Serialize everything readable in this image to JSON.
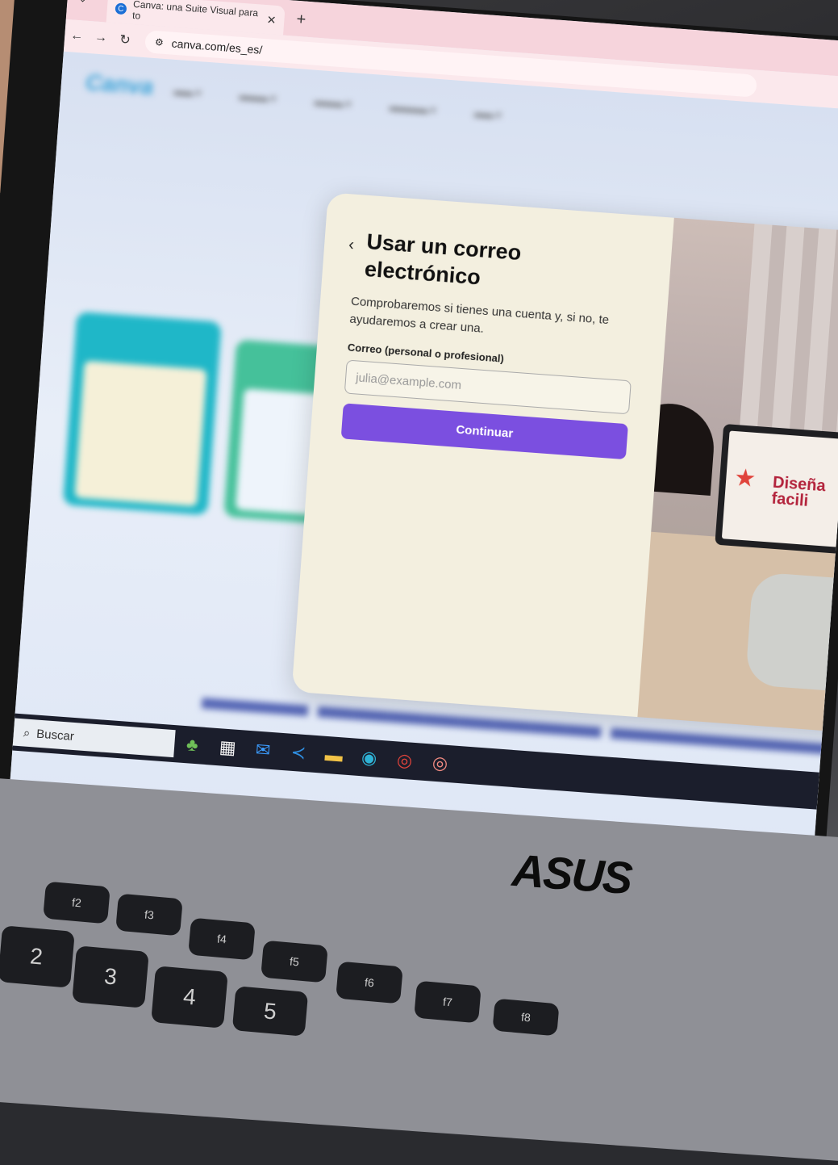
{
  "browser": {
    "tab_title": "Canva: una Suite Visual para to",
    "favicon_letter": "C",
    "close_tab": "✕",
    "new_tab": "+",
    "url": "canva.com/es_es/"
  },
  "modal": {
    "back_icon": "‹",
    "title": "Usar un correo electrónico",
    "description": "Comprobaremos si tienes una cuenta y, si no, te ayudaremos a crear una.",
    "email_label": "Correo (personal o profesional)",
    "email_placeholder": "julia@example.com",
    "continue_button": "Continuar"
  },
  "photo_screen": {
    "promo_text": "Diseña facili"
  },
  "taskbar": {
    "search_label": "Buscar"
  },
  "laptop_brand": "ASUS",
  "keyboard": {
    "keys": [
      "2",
      "3",
      "4",
      "5"
    ],
    "fn_keys": [
      "f2",
      "f3",
      "f4",
      "f5",
      "f6",
      "f7",
      "f8"
    ]
  },
  "colors": {
    "accent": "#7b4fe0",
    "tab_bar": "#f6d4dc",
    "modal_bg": "#f3efdf"
  }
}
